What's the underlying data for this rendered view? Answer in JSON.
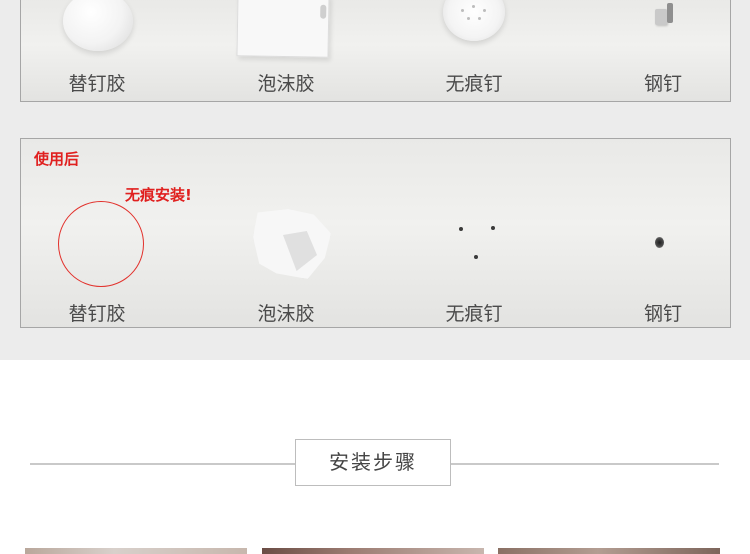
{
  "comparison": {
    "before_panel": {
      "products": [
        {
          "name": "替钉胶"
        },
        {
          "name": "泡沫胶"
        },
        {
          "name": "无痕钉"
        },
        {
          "name": "钢钉"
        }
      ]
    },
    "after_panel": {
      "tag": "使用后",
      "note": "无痕安装!",
      "products": [
        {
          "name": "替钉胶"
        },
        {
          "name": "泡沫胶"
        },
        {
          "name": "无痕钉"
        },
        {
          "name": "钢钉"
        }
      ]
    }
  },
  "steps_section": {
    "title": "安装步骤"
  },
  "colors": {
    "accent_red": "#e0201f",
    "caption_gray": "#4a4a4a",
    "band_gray": "#ececec"
  }
}
